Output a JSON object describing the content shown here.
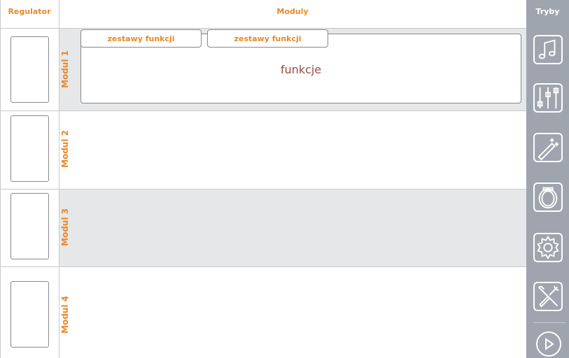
{
  "headers": {
    "regulator": "Regulator",
    "moduly": "Moduly",
    "tryby": "Tryby"
  },
  "modules": [
    {
      "label": "Modul 1"
    },
    {
      "label": "Modul 2"
    },
    {
      "label": "Modul 3"
    },
    {
      "label": "Modul 4"
    }
  ],
  "module1": {
    "tabs": [
      "zestawy funkcji",
      "zestawy funkcji"
    ],
    "functions_label": "funkcje"
  },
  "sidebar": {
    "icons": [
      "music-note-icon",
      "mixer-sliders-icon",
      "magic-wand-icon",
      "drum-icon",
      "gear-icon",
      "tools-icon",
      "play-icon"
    ]
  },
  "colors": {
    "accent": "#e8892a",
    "sidebar": "#9ea5ae",
    "row_alt": "#e6e7e9",
    "function_text": "#9a4a3e"
  }
}
